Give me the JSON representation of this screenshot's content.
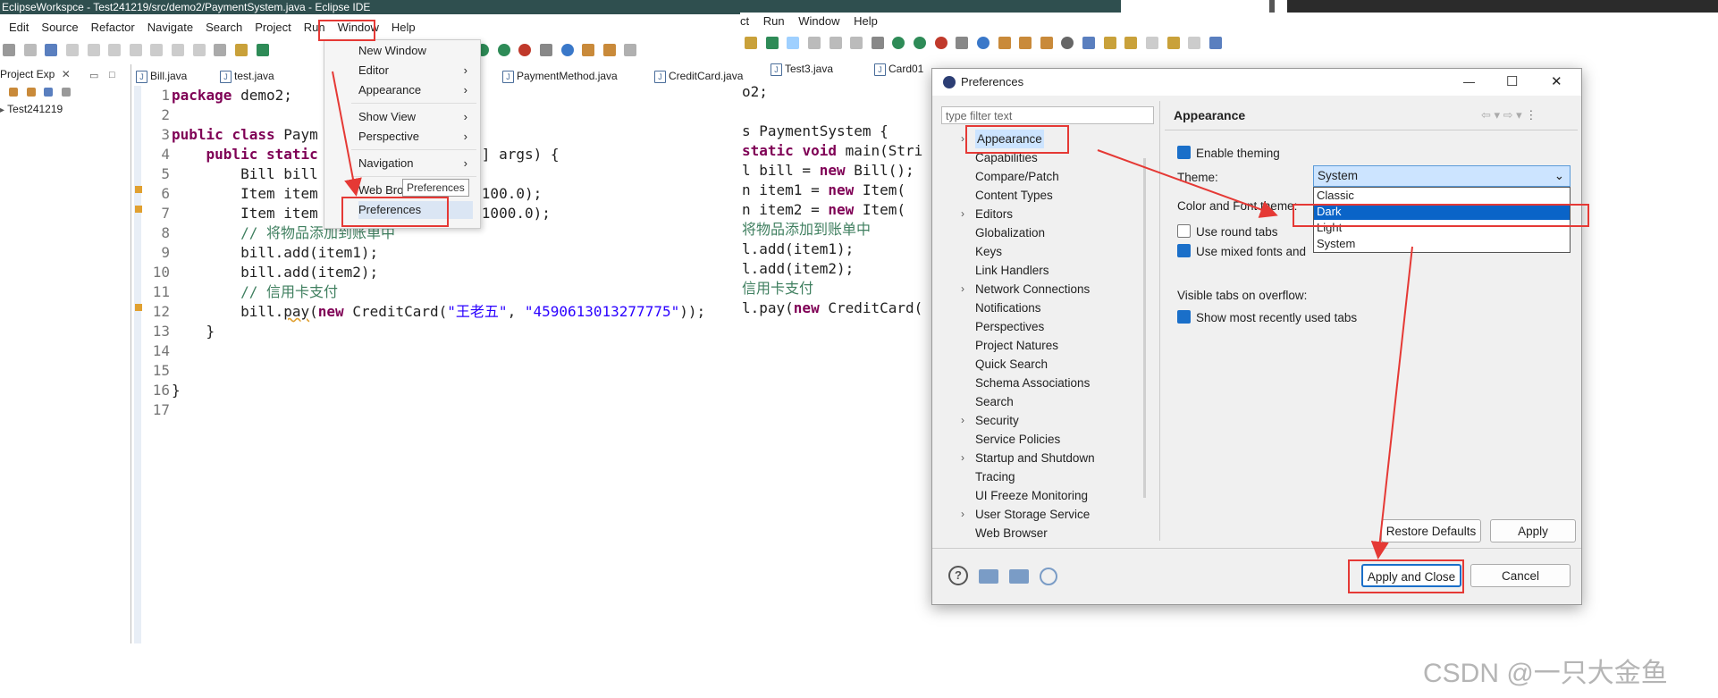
{
  "window": {
    "title": "EclipseWorkspce - Test241219/src/demo2/PaymentSystem.java - Eclipse IDE"
  },
  "menubar": [
    "Edit",
    "Source",
    "Refactor",
    "Navigate",
    "Search",
    "Project",
    "Run",
    "Window",
    "Help"
  ],
  "menubar2": [
    "ct",
    "Run",
    "Window",
    "Help"
  ],
  "window_menu": {
    "items": [
      "New Window",
      "Editor",
      "Appearance",
      "Show View",
      "Perspective",
      "Navigation",
      "Web Bro",
      "Preferences"
    ],
    "tooltip": "Preferences"
  },
  "left_panel": {
    "tab": "Project Exp",
    "project": "Test241219"
  },
  "editor_tabs": [
    "Bill.java",
    "test.java",
    "PaymentMethod.java",
    "CreditCard.java"
  ],
  "editor_tabs2": [
    "Test3.java",
    "Card01"
  ],
  "code": {
    "line_numbers": [
      "1",
      "2",
      "3",
      "4",
      "5",
      "6",
      "7",
      "8",
      "9",
      "10",
      "11",
      "12",
      "13",
      "14",
      "15",
      "16",
      "17"
    ],
    "l1_kw": "package",
    "l1_rest": " demo2;",
    "l3_kw1": "public",
    "l3_kw2": "class",
    "l3_rest": " Paym",
    "l4_kw1": "public",
    "l4_kw2": "static",
    "l4_rest": "] args) {",
    "l5": "Bill bill",
    "l6a": "Item item",
    "l6b": ", 100.0);",
    "l7a": "Item item",
    "l7b": ", 1000.0);",
    "l8": "// 将物品添加到账单中",
    "l9": "bill.add(item1);",
    "l10": "bill.add(item2);",
    "l11": "// 信用卡支付",
    "l12a": "bill.",
    "l12b": "pay",
    "l12c": "(",
    "l12kw": "new",
    "l12d": " CreditCard(",
    "l12s1": "\"王老五\"",
    "l12e": ", ",
    "l12s2": "\"4590613013277775\"",
    "l12f": "));",
    "l13": "}",
    "l16": "}"
  },
  "code2": {
    "l0": "o2;",
    "l3a": "s PaymentSystem {",
    "l4kw": "static",
    "l4kw2": "void",
    "l4rest": " main(Stri",
    "l5a": "l bill = ",
    "l5kw": "new",
    "l5b": " Bill();",
    "l6a": "n item1 = ",
    "l6kw": "new",
    "l6b": " Item(",
    "l7a": "n item2 = ",
    "l7kw": "new",
    "l7b": " Item(",
    "l8": "将物品添加到账单中",
    "l9": "l.add(item1);",
    "l10": "l.add(item2);",
    "l11": "信用卡支付",
    "l12a": "l.pay(",
    "l12kw": "new",
    "l12b": " CreditCard("
  },
  "dialog": {
    "title": "Preferences",
    "filter_placeholder": "type filter text",
    "tree": [
      "Appearance",
      "Capabilities",
      "Compare/Patch",
      "Content Types",
      "Editors",
      "Globalization",
      "Keys",
      "Link Handlers",
      "Network Connections",
      "Notifications",
      "Perspectives",
      "Project Natures",
      "Quick Search",
      "Schema Associations",
      "Search",
      "Security",
      "Service Policies",
      "Startup and Shutdown",
      "Tracing",
      "UI Freeze Monitoring",
      "User Storage Service",
      "Web Browser"
    ],
    "page_title": "Appearance",
    "enable_theming": "Enable theming",
    "theme_label": "Theme:",
    "theme_value": "System",
    "theme_options": [
      "Classic",
      "Dark",
      "Light",
      "System"
    ],
    "color_font_theme_label": "Color and Font theme:",
    "use_round_tabs": "Use round tabs",
    "use_mixed_fonts": "Use mixed fonts and",
    "visible_tabs_label": "Visible tabs on overflow:",
    "show_recent_tabs": "Show most recently used tabs",
    "restore_defaults": "Restore Defaults",
    "apply": "Apply",
    "apply_close": "Apply and Close",
    "cancel": "Cancel"
  },
  "watermark": "CSDN @一只大金鱼",
  "colors": {
    "highlight": "#e53935",
    "selection": "#0a64c8",
    "keyword": "#7f0055",
    "string": "#2a00ff",
    "comment": "#3f7f5f"
  }
}
